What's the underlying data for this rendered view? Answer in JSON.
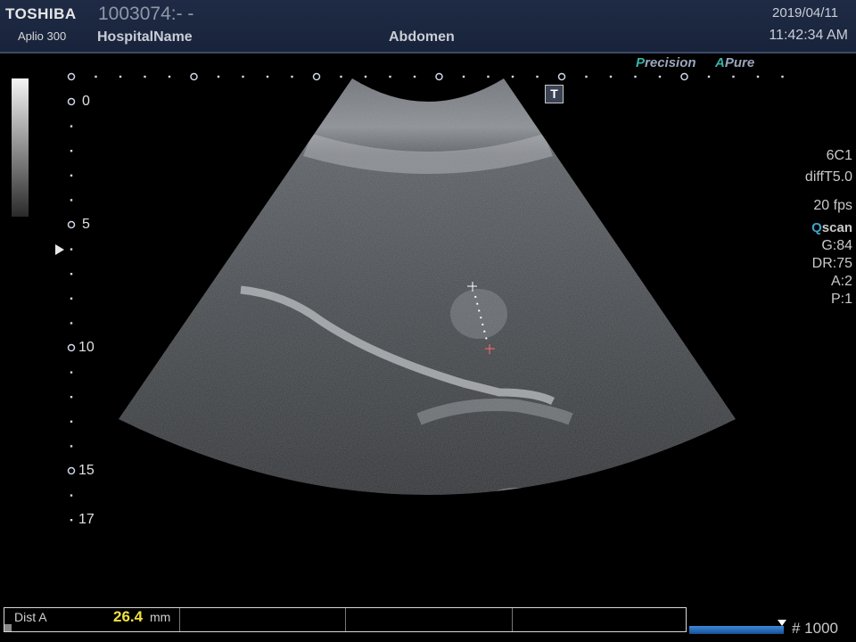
{
  "header": {
    "brand": "TOSHIBA",
    "model": "Aplio 300",
    "patient_id": "1003074:- -",
    "hospital": "HospitalName",
    "exam": "Abdomen",
    "date": "2019/04/11",
    "time": "11:42:34 AM"
  },
  "badges": {
    "precision_initial": "P",
    "precision_rest": "recision",
    "pure_initial": "A",
    "pure_rest": "Pure",
    "t_icon": "T"
  },
  "depth_scale": {
    "labels": [
      "0",
      "5",
      "10",
      "15",
      "17"
    ]
  },
  "params": {
    "probe": "6C1",
    "mode": "diffT5.0",
    "fps": "20 fps",
    "qscan_initial": "Q",
    "qscan_rest": "scan",
    "gain": "G:84",
    "dynamic_range": "DR:75",
    "a": "A:2",
    "p": "P:1"
  },
  "measurement": {
    "label": "Dist A",
    "value": "26.4",
    "unit": "mm"
  },
  "cine": {
    "frame": "# 1000"
  },
  "colors": {
    "header_bg": "#1f2b45",
    "accent_teal": "#37b3a8",
    "measure_value": "#f0e040",
    "cine_bar": "#3a8ad8"
  }
}
